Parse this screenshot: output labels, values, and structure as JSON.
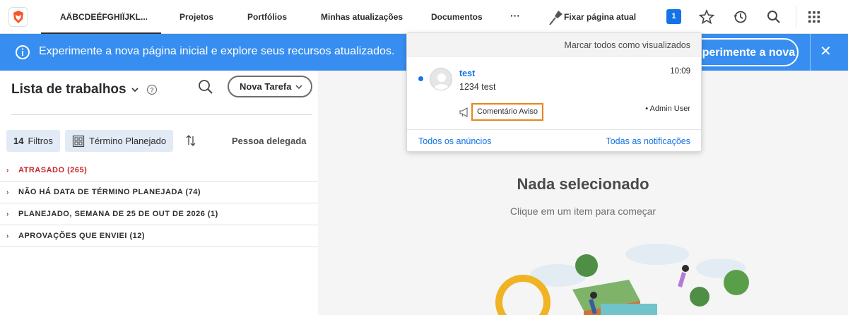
{
  "topbar": {
    "brand": "AÄBCDEÉFGHIÏJKL...",
    "nav": [
      "Projetos",
      "Portfólios",
      "Minhas atualizações",
      "Documentos"
    ],
    "more": "···",
    "pin_label": "Fixar página atual",
    "notification_count": "1",
    "icons": [
      "brand-logo-icon",
      "pin-icon",
      "star-icon",
      "history-icon",
      "search-icon",
      "apps-grid-icon"
    ]
  },
  "banner": {
    "text": "Experimente a nova página inicial e explore seus recursos atualizados.",
    "button": "Experimente a nova página inicial",
    "close": "✕"
  },
  "left": {
    "title": "Lista de trabalhos",
    "new_task": "Nova Tarefa",
    "filters_count": "14",
    "filters_label": "Filtros",
    "grouping": "Término Planejado",
    "assignee": "Pessoa delegada",
    "groups": [
      {
        "label": "ATRASADO (265)",
        "color": "#c9252d"
      },
      {
        "label": "NÃO HÁ DATA DE TÉRMINO PLANEJADA (74)",
        "color": "#2c2c2c"
      },
      {
        "label": "PLANEJADO, SEMANA DE 25 DE OUT DE 2026 (1)",
        "color": "#2c2c2c"
      },
      {
        "label": "APROVAÇÕES QUE ENVIEI (12)",
        "color": "#2c2c2c"
      }
    ]
  },
  "right": {
    "empty_title": "Nada selecionado",
    "empty_sub": "Clique em um item para começar"
  },
  "notifications": {
    "mark_all": "Marcar todos como visualizados",
    "item": {
      "name": "test",
      "message": "1234 test",
      "time": "10:09",
      "type": "Comentário Aviso",
      "by": "• Admin User"
    },
    "all_announcements": "Todos os anúncios",
    "all_notifications": "Todas as notificações"
  },
  "colors": {
    "accent": "#1473e6",
    "banner": "#378ef0",
    "highlight": "#e68619"
  }
}
